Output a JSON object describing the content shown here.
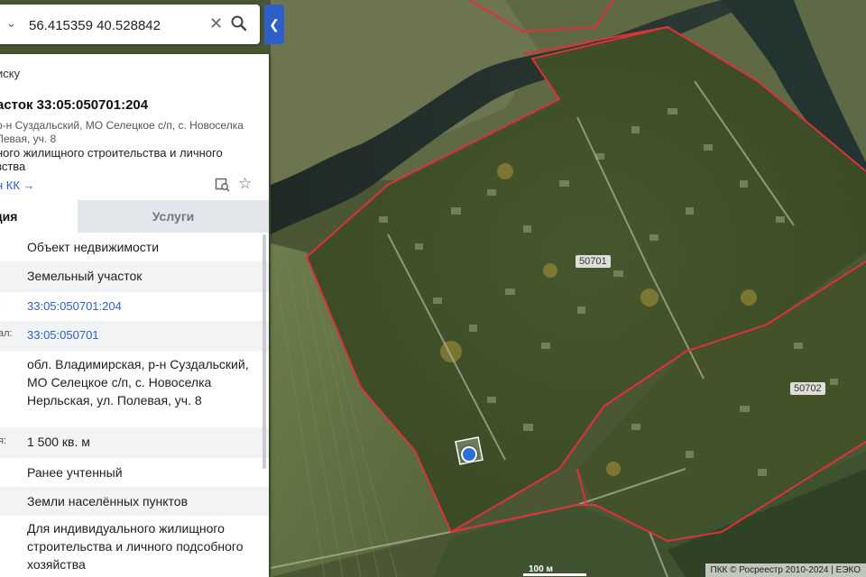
{
  "search": {
    "value": "56.415359 40.528842",
    "clear_icon": "close-icon",
    "search_icon": "search-icon"
  },
  "panel": {
    "back_label": "иску",
    "title": "асток 33:05:050701:204",
    "address": "р-н Суздальский, МО Селецкое с/п, с. Новоселка Левая, уч. 8",
    "purpose": "ного жилищного строительства и личного зства",
    "kk_link": "н КК →",
    "tabs": {
      "info": "ция",
      "services": "Услуги"
    },
    "rows": [
      {
        "label": "",
        "value": "Объект недвижимости"
      },
      {
        "label": "",
        "value": "Земельный участок"
      },
      {
        "label": ":",
        "value": "33:05:050701:204"
      },
      {
        "label": "ал:",
        "value": "33:05:050701"
      },
      {
        "label": "",
        "value": "обл. Владимирская, р-н Суздальский, МО Селецкое с/п, с. Новоселка Нерльская, ул. Полевая, уч. 8"
      },
      {
        "label": "я:",
        "value": "1 500 кв. м"
      },
      {
        "label": "",
        "value": "Ранее учтенный"
      },
      {
        "label": "",
        "value": "Земли населённых пунктов"
      },
      {
        "label": "",
        "value": "Для индивидуального жилищного строительства и личного подсобного хозяйства"
      }
    ]
  },
  "map": {
    "labels": {
      "quarter_1": "50701",
      "quarter_2": "50702"
    },
    "scale": "100 м",
    "copyright": "ПКК © Росреестр 2010-2024 | ЕЭКО",
    "boundary_color": "#e0313a",
    "marker_color": "#2c6fd8"
  }
}
